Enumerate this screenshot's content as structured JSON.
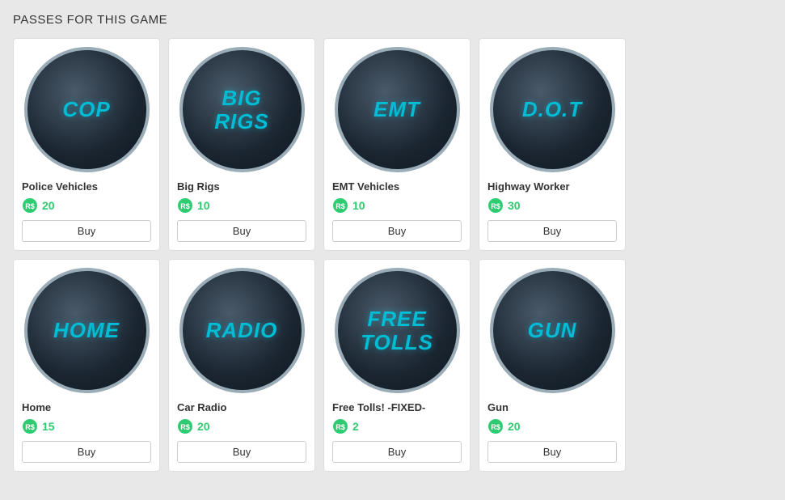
{
  "page": {
    "title": "PASSES FOR THIS GAME"
  },
  "passes": [
    {
      "id": "cop",
      "icon_text": "COP",
      "name": "Police Vehicles",
      "price": 20,
      "buy_label": "Buy"
    },
    {
      "id": "big-rigs",
      "icon_text": "BIG\nRIGS",
      "name": "Big Rigs",
      "price": 10,
      "buy_label": "Buy"
    },
    {
      "id": "emt",
      "icon_text": "EMT",
      "name": "EMT Vehicles",
      "price": 10,
      "buy_label": "Buy"
    },
    {
      "id": "dot",
      "icon_text": "D.O.T",
      "name": "Highway Worker",
      "price": 30,
      "buy_label": "Buy"
    },
    {
      "id": "home",
      "icon_text": "HOME",
      "name": "Home",
      "price": 15,
      "buy_label": "Buy"
    },
    {
      "id": "radio",
      "icon_text": "RADIO",
      "name": "Car Radio",
      "price": 20,
      "buy_label": "Buy"
    },
    {
      "id": "free-tolls",
      "icon_text": "FREE\nTOLLS",
      "name": "Free Tolls! -FIXED-",
      "price": 2,
      "buy_label": "Buy"
    },
    {
      "id": "gun",
      "icon_text": "GUN",
      "name": "Gun",
      "price": 20,
      "buy_label": "Buy"
    }
  ],
  "robux_symbol": "R$"
}
